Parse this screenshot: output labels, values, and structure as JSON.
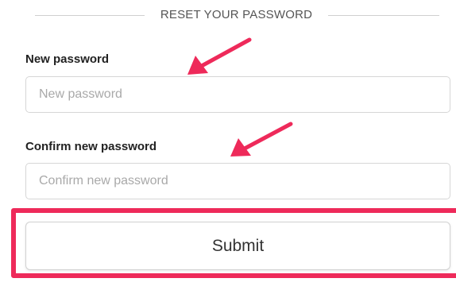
{
  "header": {
    "title": "RESET YOUR PASSWORD"
  },
  "form": {
    "new_password": {
      "label": "New password",
      "placeholder": "New password",
      "value": ""
    },
    "confirm_password": {
      "label": "Confirm new password",
      "placeholder": "Confirm new password",
      "value": ""
    },
    "submit_label": "Submit"
  },
  "annotations": {
    "arrow_color": "#ee2a5a",
    "highlight_color": "#ee2a5a",
    "arrow_icon": "pointer-arrow-icon",
    "highlight": "submit-button"
  }
}
